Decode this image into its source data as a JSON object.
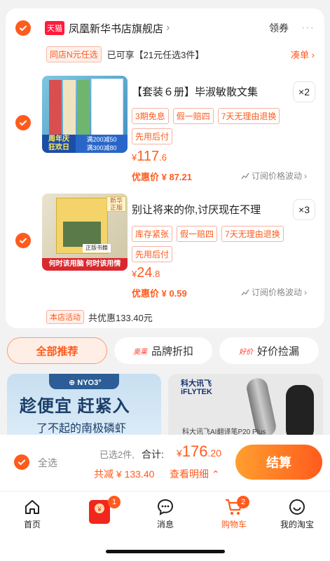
{
  "store": {
    "tmall_badge": "天猫",
    "name": "凤凰新华书店旗舰店",
    "coupon_label": "领券",
    "more_label": "···",
    "promo_tag": "同店N元任选",
    "promo_text": "已可享【21元任选3件】",
    "promo_link": "凑单 ›"
  },
  "items": [
    {
      "title": "【套装６册】毕淑敏散文集",
      "qty": "×2",
      "tags": [
        "3期免息",
        "假一赔四",
        "7天无理由退换",
        "先用后付"
      ],
      "price_currency": "¥",
      "price_int": "117",
      "price_dec": ".6",
      "discount": "优惠价 ¥ 87.21",
      "subscribe": "订阅价格波动",
      "cover_text_1": "周年庆",
      "cover_text_2": "狂欢日",
      "cover_text_3": "满200减50",
      "cover_text_4": "满300减80"
    },
    {
      "title": "别让将来的你,讨厌现在不理",
      "qty": "×3",
      "tags": [
        "库存紧张",
        "假一赔四",
        "7天无理由退换",
        "先用后付"
      ],
      "price_currency": "¥",
      "price_int": "24",
      "price_dec": ".8",
      "discount": "优惠价 ¥ 0.59",
      "subscribe": "订阅价格波动",
      "cover_text_1": "何时该用脑 何时该用情",
      "cover_text_2": "正版书籍",
      "cover_text_3": "新华正版"
    }
  ],
  "activity": {
    "tag": "本店活动",
    "text": "共优惠133.40元"
  },
  "recommend": {
    "tab_all": "全部推荐",
    "tab_brand_mini": "奥莱",
    "tab_brand": "品牌折扣",
    "tab_deal_mini": "好价",
    "tab_deal": "好价捡漏"
  },
  "banners": {
    "left_brand": "⊕ NYO3°",
    "left_title": "趁便宜  赶紧入",
    "left_sub": "了不起的南极磷虾",
    "right_logo_1": "科大讯飞",
    "right_logo_2": "iFLYTEK",
    "right_caption": "科大讯飞AI翻译笔P20 Plus"
  },
  "checkout": {
    "select_all": "全选",
    "selected": "已选2件,",
    "total_label": "合计:",
    "total_currency": "¥",
    "total_int": "176",
    "total_dec": ".20",
    "savings": "共减 ¥ 133.40",
    "detail": "查看明细 ⌃",
    "pay": "结算"
  },
  "tabbar": {
    "home": "首页",
    "redpacket_badge": "1",
    "messages": "消息",
    "cart": "购物车",
    "cart_badge": "2",
    "mine": "我的淘宝"
  },
  "colors": {
    "accent": "#ff5b1d",
    "tmall": "#ff1b3c"
  }
}
